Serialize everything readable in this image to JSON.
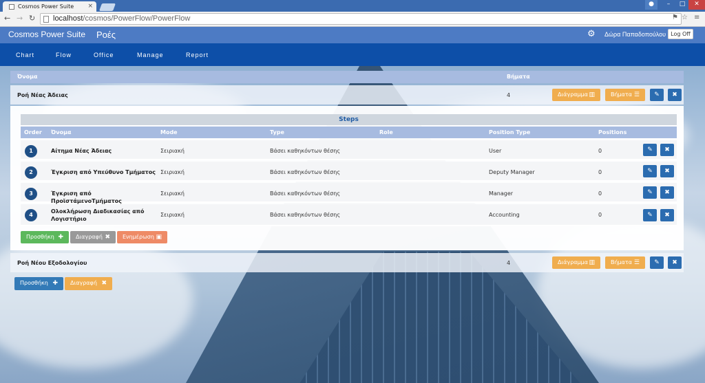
{
  "browser": {
    "tab_title": "Cosmos Power Suite",
    "url_host": "localhost",
    "url_path": "/cosmos/PowerFlow/PowerFlow"
  },
  "app": {
    "brand": "Cosmos Power Suite",
    "page_title": "Ροές",
    "username": "Δώρα Παπαδοπούλου",
    "logoff": "Log Off"
  },
  "menu": [
    "Chart",
    "Flow",
    "Office",
    "Manage",
    "Report"
  ],
  "grid": {
    "col_name": "Όνομα",
    "col_steps": "Βήματα"
  },
  "flows": [
    {
      "name": "Ροή Νέας Άδειας",
      "steps": "4",
      "diagram_label": "Διάγραμμα",
      "steps_label": "Βήματα"
    },
    {
      "name": "Ροή Νέου Εξοδολογίου",
      "steps": "4",
      "diagram_label": "Διάγραμμα",
      "steps_label": "Βήματα"
    }
  ],
  "steps_panel": {
    "title": "Steps",
    "headers": {
      "order": "Order",
      "name": "Όνομα",
      "mode": "Mode",
      "type": "Type",
      "role": "Role",
      "position_type": "Position Type",
      "positions": "Positions"
    },
    "rows": [
      {
        "order": "1",
        "name": "Αίτημα Νέας Άδειας",
        "mode": "Σειριακή",
        "type": "Βάσει καθηκόντων θέσης",
        "role": "",
        "position_type": "User",
        "positions": "0"
      },
      {
        "order": "2",
        "name": "Έγκριση από Υπεύθυνο Τμήματος",
        "mode": "Σειριακή",
        "type": "Βάσει καθηκόντων θέσης",
        "role": "",
        "position_type": "Deputy Manager",
        "positions": "0"
      },
      {
        "order": "3",
        "name": "Έγκριση από ΠροϊστάμενοΤμήματος",
        "mode": "Σειριακή",
        "type": "Βάσει καθηκόντων θέσης",
        "role": "",
        "position_type": "Manager",
        "positions": "0"
      },
      {
        "order": "4",
        "name": "Ολοκλήρωση Διαδικασίας από Λογιστήριο",
        "mode": "Σειριακή",
        "type": "Βάσει καθηκόντων θέσης",
        "role": "",
        "position_type": "Accounting",
        "positions": "0"
      }
    ],
    "add_label": "Προσθήκη",
    "delete_label": "Διαγραφή",
    "update_label": "Ενημέρωση"
  },
  "page_actions": {
    "add_label": "Προσθήκη",
    "delete_label": "Διαγραφή"
  },
  "colors": {
    "header": "#4d7bc4",
    "menubar": "#0d4fa8",
    "orange": "#f0ad4e",
    "blue_action": "#2b6cb0",
    "green": "#5cb85c"
  }
}
